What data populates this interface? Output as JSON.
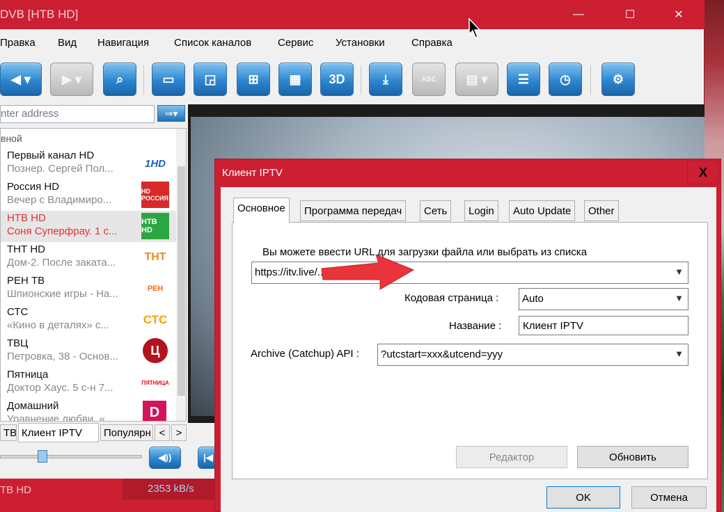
{
  "window": {
    "title": "DVB [НТВ HD]",
    "controls": {
      "minimize": "—",
      "maximize": "☐",
      "close": "✕"
    }
  },
  "menu": [
    "Правка",
    "Вид",
    "Навигация",
    "Список каналов",
    "Сервис",
    "Установки",
    "Справка"
  ],
  "toolbar": {
    "buttons": [
      "back-icon",
      "forward-icon",
      "search-icon",
      "window-icon",
      "screen-icon",
      "grid4-icon",
      "grid16-icon",
      "3d-icon",
      "record-icon",
      "subtitles-icon",
      "teletext-icon",
      "epg-list-icon",
      "clock-icon",
      "settings-icon"
    ],
    "label_3d": "3D",
    "label_abc": "ABC"
  },
  "address": {
    "placeholder": "Enter address",
    "visible_text": "nter address"
  },
  "channel_list": {
    "group": "вной",
    "channels": [
      {
        "name": "Первый канал HD",
        "program": "Познер. Сергей Пол...",
        "logo": "1HD"
      },
      {
        "name": "Россия HD",
        "program": "Вечер с Владимиро...",
        "logo": "HD РОССИЯ"
      },
      {
        "name": "НТВ HD",
        "program": "Соня Суперфрау. 1 с...",
        "logo": "НТВ HD",
        "selected": true
      },
      {
        "name": "ТНТ HD",
        "program": "Дом-2. После заката...",
        "logo": "ТНТ"
      },
      {
        "name": "РЕН ТВ",
        "program": "Шпионские игры - На...",
        "logo": "РЕН"
      },
      {
        "name": "СТС",
        "program": "«Кино в деталях» с...",
        "logo": "СТС"
      },
      {
        "name": "ТВЦ",
        "program": "Петровка, 38 - Основ...",
        "logo": "Ц"
      },
      {
        "name": "Пятница",
        "program": "Доктор Хаус. 5 с-н 7...",
        "logo": "ПЯТНИЦА"
      },
      {
        "name": "Домашний",
        "program": "Уравнение любви. «...",
        "logo": "D"
      }
    ]
  },
  "bottom_tabs": [
    "ТВ",
    "Клиент IPTV",
    "Популярн",
    "<",
    ">"
  ],
  "status": {
    "channel": "ТВ HD",
    "bitrate": "2353 kB/s"
  },
  "dialog": {
    "title": "Клиент IPTV",
    "close": "X",
    "tabs": [
      "Основное",
      "Программа передач",
      "Сеть",
      "Login",
      "Auto Update",
      "Other"
    ],
    "url_hint": "Вы можете ввести URL для загрузки файла или выбрать из списка",
    "url_value": "https://itv.live/.../perfectpl.m3u8",
    "codepage_label": "Кодовая страница :",
    "codepage_value": "Auto",
    "name_label": "Название :",
    "name_value": "Клиент IPTV",
    "archive_label": "Archive (Catchup) API :",
    "archive_value": "?utcstart=xxx&utcend=yyy",
    "editor_button": "Редактор",
    "refresh_button": "Обновить",
    "ok_button": "OK",
    "cancel_button": "Отмена"
  },
  "colors": {
    "title_red": "#cc1f32",
    "accent_blue": "#2d86cf",
    "arrow_red": "#e8343a"
  }
}
